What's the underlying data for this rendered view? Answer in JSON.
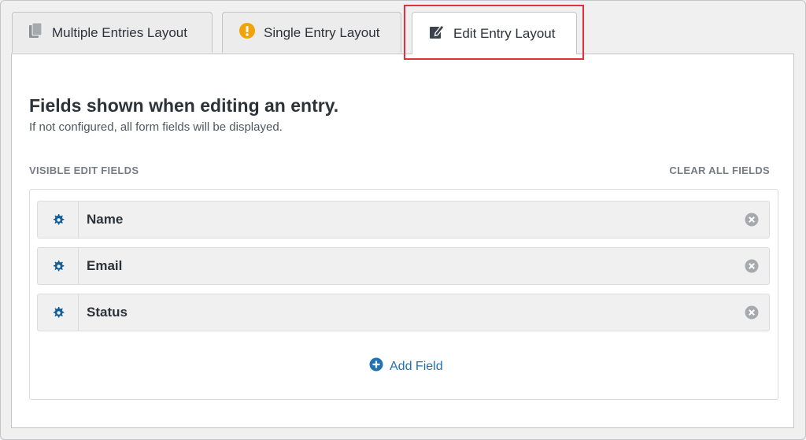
{
  "tabs": [
    {
      "label": "Multiple Entries Layout",
      "icon": "copy-icon"
    },
    {
      "label": "Single Entry Layout",
      "icon": "warning-icon"
    },
    {
      "label": "Edit Entry Layout",
      "icon": "edit-icon",
      "active": true
    }
  ],
  "panel": {
    "heading": "Fields shown when editing an entry.",
    "subtext": "If not configured, all form fields will be displayed.",
    "section_label": "VISIBLE EDIT FIELDS",
    "clear_label": "CLEAR ALL FIELDS",
    "fields": [
      {
        "label": "Name"
      },
      {
        "label": "Email"
      },
      {
        "label": "Status"
      }
    ],
    "add_label": "Add Field"
  },
  "colors": {
    "accent": "#2271b1",
    "gear": "#135e96",
    "warning": "#f0a30a",
    "highlight": "#e0313c"
  }
}
